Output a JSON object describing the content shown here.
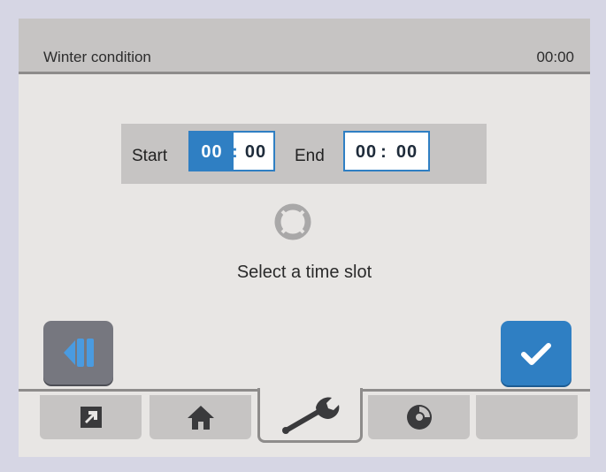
{
  "header": {
    "title": "Winter condition",
    "clock": "00:00"
  },
  "time_slot": {
    "start_label": "Start",
    "start_hours": "00",
    "start_separator": ":",
    "start_minutes": "00",
    "end_label": "End",
    "end_hours": "00",
    "end_separator": ":",
    "end_minutes": "00"
  },
  "hint": "Select a time slot",
  "colors": {
    "accent": "#2f7fc3",
    "panel": "#c6c4c3",
    "background": "#e8e6e4",
    "back_button": "#76777f"
  },
  "icons": {
    "status": "lifebuoy-icon",
    "back": "back-icon",
    "confirm": "checkmark-icon",
    "tabs": [
      "external-link-icon",
      "home-icon",
      "wrench-icon",
      "disc-icon",
      ""
    ]
  },
  "tabs": {
    "active_index": 2
  }
}
